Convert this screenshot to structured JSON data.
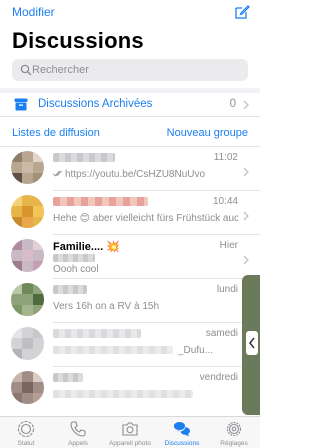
{
  "header": {
    "edit_label": "Modifier",
    "title": "Discussions",
    "compose_icon": "compose-icon"
  },
  "search": {
    "placeholder": "Rechercher",
    "icon": "search-icon"
  },
  "archived": {
    "label": "Discussions Archivées",
    "count": "0",
    "icon": "archive-box-icon"
  },
  "links": {
    "broadcast": "Listes de diffusion",
    "new_group": "Nouveau groupe"
  },
  "chats": [
    {
      "name": "",
      "time": "11:02",
      "preview": "https://youtu.be/CsHZU8NuUvo",
      "read_ticks": true,
      "name_blurred": true
    },
    {
      "name": "",
      "time": "10:44",
      "preview": "Hehe 😊 aber vielleicht fürs Frühstück auch",
      "read_ticks": false,
      "name_blurred": true
    },
    {
      "name": "Familie.... 💥",
      "time": "Hier",
      "preview": "Oooh cool",
      "read_ticks": false,
      "name_blurred": false
    },
    {
      "name": "",
      "time": "lundi",
      "preview": "Vers 16h on a RV à 15h",
      "read_ticks": false,
      "name_blurred": true
    },
    {
      "name": "",
      "time": "samedi",
      "preview": "_Dufu...",
      "read_ticks": false,
      "name_blurred": true
    },
    {
      "name": "",
      "time": "vendredi",
      "preview": "",
      "read_ticks": false,
      "name_blurred": true
    }
  ],
  "tabbar": [
    {
      "label": "Statut",
      "icon": "status-icon",
      "active": false
    },
    {
      "label": "Appels",
      "icon": "phone-icon",
      "active": false
    },
    {
      "label": "Appareil photo",
      "icon": "camera-icon",
      "active": false
    },
    {
      "label": "Discussions",
      "icon": "chat-bubbles-icon",
      "active": true
    },
    {
      "label": "Réglages",
      "icon": "gear-icon",
      "active": false
    }
  ],
  "colors": {
    "accent": "#1a7ff0",
    "secondary_text": "#8e8e93"
  }
}
